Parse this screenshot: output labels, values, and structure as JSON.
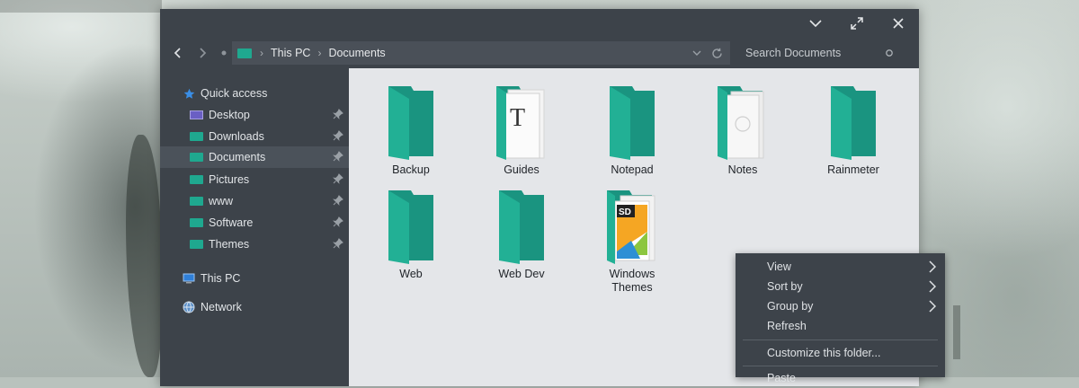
{
  "window": {
    "collapse_glyph": "chevron-down-icon",
    "maximize_glyph": "maximize-icon",
    "close_glyph": "close-icon"
  },
  "nav": {
    "back": "‹",
    "forward": "›",
    "up": "•"
  },
  "address": {
    "crumbs": [
      "This PC",
      "Documents"
    ],
    "separator": "›"
  },
  "search": {
    "placeholder": "Search Documents"
  },
  "sidebar": {
    "quick_access": "Quick access",
    "items": [
      {
        "label": "Desktop",
        "icon": "desktop-icon",
        "pinned": true
      },
      {
        "label": "Downloads",
        "icon": "folder-icon",
        "pinned": true
      },
      {
        "label": "Documents",
        "icon": "folder-icon",
        "pinned": true,
        "active": true
      },
      {
        "label": "Pictures",
        "icon": "folder-icon",
        "pinned": true
      },
      {
        "label": "www",
        "icon": "folder-icon",
        "pinned": true
      },
      {
        "label": "Software",
        "icon": "folder-icon",
        "pinned": true
      },
      {
        "label": "Themes",
        "icon": "folder-icon",
        "pinned": true
      }
    ],
    "this_pc": "This PC",
    "network": "Network"
  },
  "folders": [
    {
      "label": "Backup",
      "icon": "folder-icon"
    },
    {
      "label": "Guides",
      "icon": "folder-with-documents-icon"
    },
    {
      "label": "Notepad",
      "icon": "folder-icon"
    },
    {
      "label": "Notes",
      "icon": "folder-with-documents-icon"
    },
    {
      "label": "Rainmeter",
      "icon": "folder-icon"
    },
    {
      "label": "Web",
      "icon": "folder-icon"
    },
    {
      "label": "Web Dev",
      "icon": "folder-icon"
    },
    {
      "label": "Windows Themes",
      "label_line1": "Windows",
      "label_line2": "Themes",
      "icon": "folder-with-psd-icon"
    }
  ],
  "context_menu": {
    "items": [
      {
        "label": "View",
        "submenu": true
      },
      {
        "label": "Sort by",
        "submenu": true
      },
      {
        "label": "Group by",
        "submenu": true
      },
      {
        "label": "Refresh",
        "submenu": false
      },
      {
        "label": "Customize this folder...",
        "submenu": false
      },
      {
        "label": "Paste",
        "submenu": false
      }
    ]
  },
  "colors": {
    "accent_folder": "#1fa88f",
    "chrome": "#3d434a",
    "content_bg": "#e4e6e9"
  }
}
